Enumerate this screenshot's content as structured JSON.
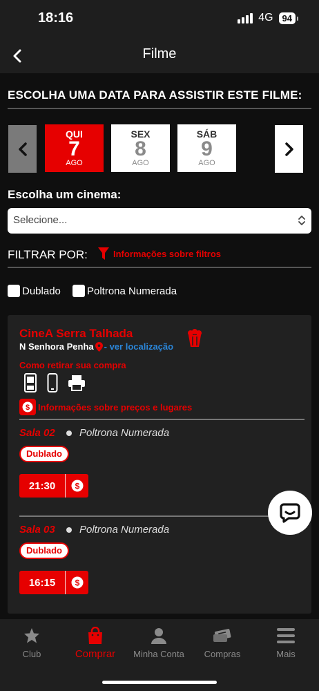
{
  "status_bar": {
    "time": "18:16",
    "network": "4G",
    "battery": "94"
  },
  "header": {
    "title": "Filme"
  },
  "date_section": {
    "title": "ESCOLHA UMA DATA PARA ASSISTIR ESTE FILME:",
    "dates": [
      {
        "dow": "QUI",
        "day": "7",
        "month": "AGO",
        "selected": true
      },
      {
        "dow": "SEX",
        "day": "8",
        "month": "AGO",
        "selected": false
      },
      {
        "dow": "SÁB",
        "day": "9",
        "month": "AGO",
        "selected": false
      }
    ]
  },
  "cinema_select": {
    "label": "Escolha um cinema:",
    "value": "Selecione..."
  },
  "filters": {
    "label": "FILTRAR POR:",
    "info_link": "Informações sobre filtros",
    "options": [
      "Dublado",
      "Poltrona Numerada"
    ]
  },
  "cinema": {
    "name": "CineA Serra Talhada",
    "neighborhood": "N Senhora Penha",
    "location_link": "- ver localização",
    "how_to_collect": "Como retirar sua compra",
    "collect_icons": [
      "kiosk-icon",
      "phone-icon",
      "printer-icon"
    ],
    "price_info": "Informações sobre preços e lugares",
    "rooms": [
      {
        "name": "Sala 02",
        "seat_type": "Poltrona Numerada",
        "tag": "Dublado",
        "time": "21:30"
      },
      {
        "name": "Sala 03",
        "seat_type": "Poltrona Numerada",
        "tag": "Dublado",
        "time": "16:15"
      }
    ]
  },
  "bottom_nav": {
    "items": [
      {
        "label": "Club",
        "icon": "star-icon"
      },
      {
        "label": "Comprar",
        "icon": "bag-icon",
        "active": true
      },
      {
        "label": "Minha Conta",
        "icon": "user-icon"
      },
      {
        "label": "Compras",
        "icon": "tickets-icon"
      },
      {
        "label": "Mais",
        "icon": "menu-icon"
      }
    ]
  },
  "colors": {
    "accent": "#e60000",
    "link": "#2b86d9",
    "background": "#0f0f0f",
    "card": "#212121"
  }
}
